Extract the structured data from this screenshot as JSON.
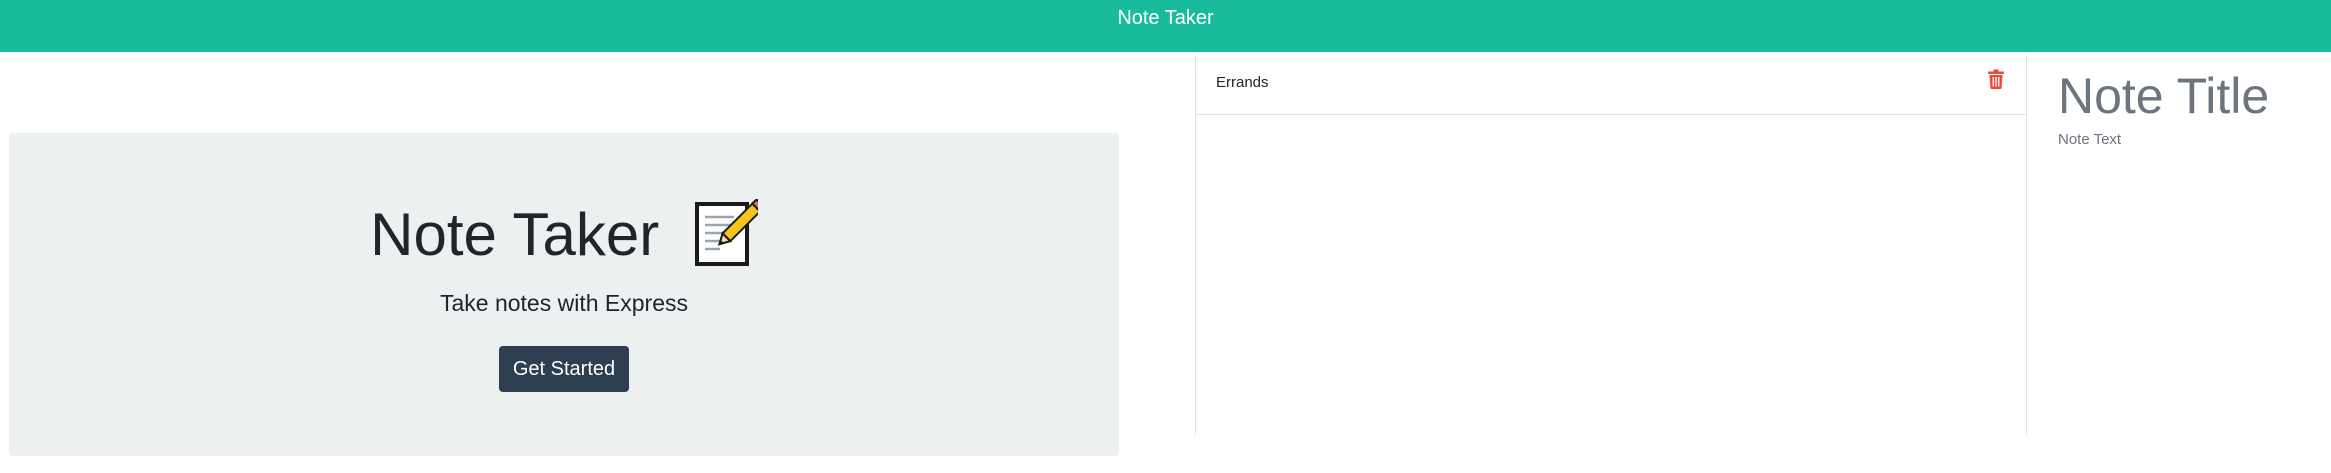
{
  "navbar": {
    "title": "Note Taker",
    "background": "#18bc9c"
  },
  "jumbotron": {
    "title": "Note Taker",
    "title_icon": "memo-icon",
    "subtitle": "Take notes with Express",
    "button_label": "Get Started",
    "button_color": "#2c3e50",
    "background": "#ecf0f1"
  },
  "notes": {
    "items": [
      {
        "title": "Errands",
        "delete_icon": "trash-icon"
      }
    ],
    "delete_color": "#e74c3c"
  },
  "editor": {
    "title_placeholder": "Note Title",
    "text_placeholder": "Note Text"
  }
}
